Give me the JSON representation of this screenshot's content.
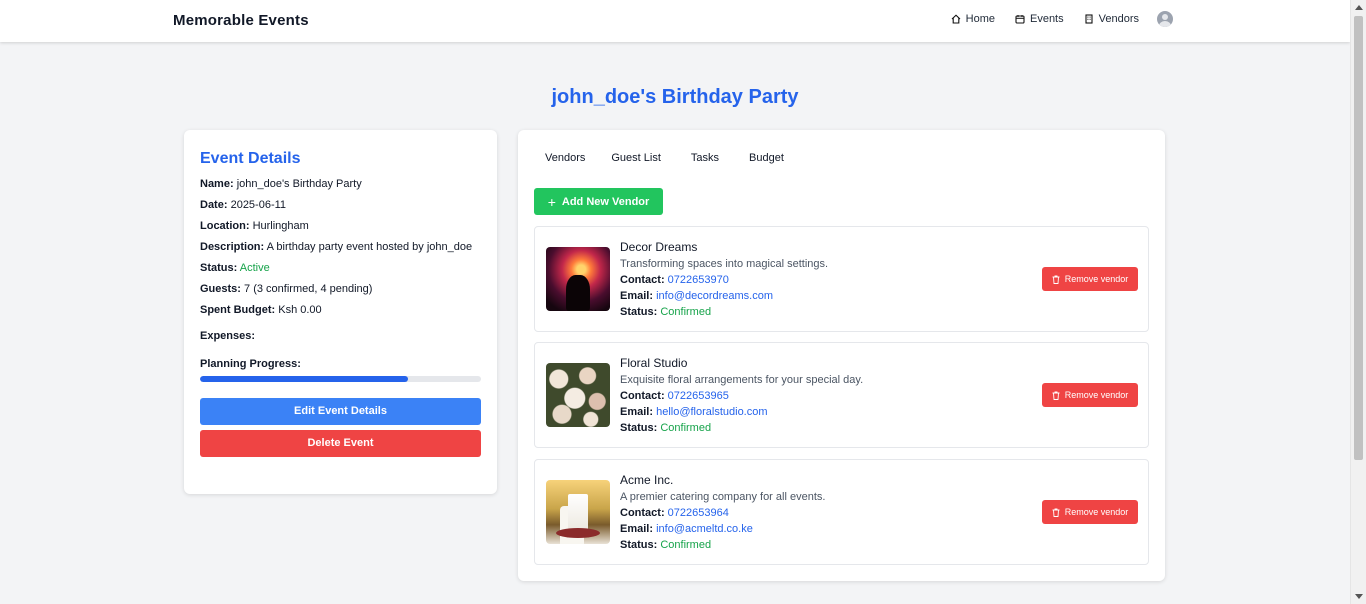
{
  "nav": {
    "brand": "Memorable Events",
    "links": [
      {
        "label": "Home",
        "icon": "home-icon"
      },
      {
        "label": "Events",
        "icon": "calendar-icon"
      },
      {
        "label": "Vendors",
        "icon": "building-icon"
      }
    ],
    "avatar": "user-avatar-icon"
  },
  "page_title": "john_doe's Birthday Party",
  "details": {
    "title": "Event Details",
    "name_label": "Name:",
    "name": "john_doe's Birthday Party",
    "date_label": "Date:",
    "date": "2025-06-11",
    "location_label": "Location:",
    "location": "Hurlingham",
    "description_label": "Description:",
    "description": "A birthday party event hosted by john_doe",
    "status_label": "Status:",
    "status": "Active",
    "guests_label": "Guests:",
    "guests": "7 (3 confirmed, 4 pending)",
    "budget_label": "Spent Budget:",
    "budget": "Ksh 0.00",
    "expenses_label": "Expenses:",
    "progress_label": "Planning Progress:",
    "progress_fraction": 0.74,
    "edit_button": "Edit Event Details",
    "delete_button": "Delete Event"
  },
  "tabs": [
    "Vendors",
    "Guest List",
    "Tasks",
    "Budget"
  ],
  "add_vendor_button": "Add New Vendor",
  "contact_label": "Contact:",
  "email_label": "Email:",
  "status_label": "Status:",
  "remove_button": "Remove vendor",
  "vendors": [
    {
      "name": "Decor Dreams",
      "description": "Transforming spaces into magical settings.",
      "contact": "0722653970",
      "email": "info@decordreams.com",
      "status": "Confirmed"
    },
    {
      "name": "Floral Studio",
      "description": "Exquisite floral arrangements for your special day.",
      "contact": "0722653965",
      "email": "hello@floralstudio.com",
      "status": "Confirmed"
    },
    {
      "name": "Acme Inc.",
      "description": "A premier catering company for all events.",
      "contact": "0722653964",
      "email": "info@acmeltd.co.ke",
      "status": "Confirmed"
    }
  ],
  "colors": {
    "primary": "#2563eb",
    "success": "#22c55e",
    "danger": "#ef4444",
    "button_blue": "#3b82f6"
  }
}
